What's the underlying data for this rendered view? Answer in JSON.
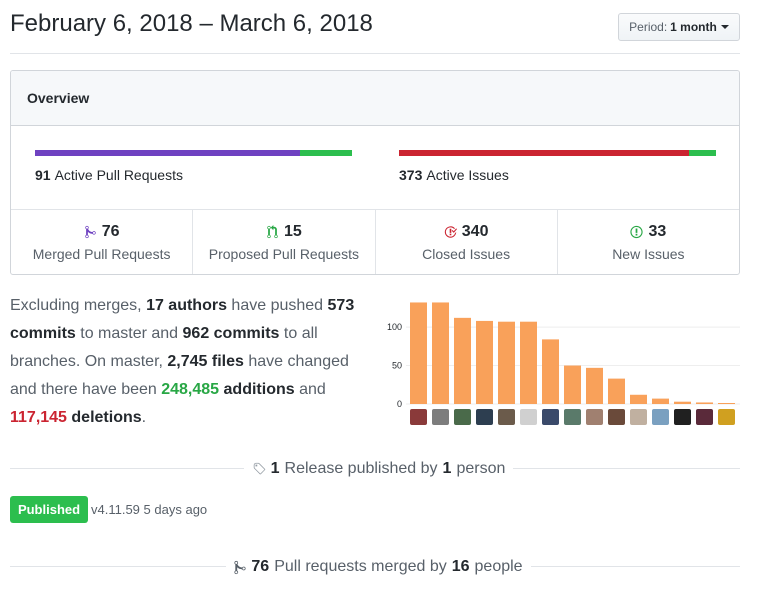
{
  "header": {
    "title": "February 6, 2018 – March 6, 2018",
    "period_label": "Period:",
    "period_value": "1 month"
  },
  "overview": {
    "heading": "Overview",
    "pull_requests": {
      "count": "91",
      "label": "Active Pull Requests",
      "merged_fraction": 0.835,
      "colors": {
        "merged": "#6f42c1",
        "proposed": "#2cbe4e"
      }
    },
    "issues": {
      "count": "373",
      "label": "Active Issues",
      "closed_fraction": 0.915,
      "colors": {
        "closed": "#cb2431",
        "new": "#2cbe4e"
      }
    },
    "stats": [
      {
        "name": "merged-pull-requests",
        "icon": "git-merge-icon",
        "num": "76",
        "label": "Merged Pull Requests",
        "color": "#6f42c1"
      },
      {
        "name": "proposed-pull-requests",
        "icon": "git-pull-request-icon",
        "num": "15",
        "label": "Proposed Pull Requests",
        "color": "#28a745"
      },
      {
        "name": "closed-issues",
        "icon": "issue-closed-icon",
        "num": "340",
        "label": "Closed Issues",
        "color": "#cb2431"
      },
      {
        "name": "new-issues",
        "icon": "issue-opened-icon",
        "num": "33",
        "label": "New Issues",
        "color": "#28a745"
      }
    ]
  },
  "narrative": {
    "t1": "Excluding merges, ",
    "authors": "17 authors",
    "t2": " have pushed ",
    "commits_master": "573 commits",
    "t3": " to master and ",
    "commits_all": "962 commits",
    "t4": " to all branches. On master, ",
    "files": "2,745 files",
    "t5": " have changed and there have been ",
    "additions_num": "248,485",
    "additions_word": "additions",
    "t6": " and ",
    "deletions_num": "117,145",
    "deletions_word": "deletions",
    "t7": "."
  },
  "chart_data": {
    "type": "bar",
    "y_ticks": [
      "100",
      "50",
      "0"
    ],
    "ylim": [
      0,
      130
    ],
    "bar_color": "#f9a15a",
    "values": [
      132,
      132,
      112,
      108,
      107,
      107,
      84,
      50,
      47,
      33,
      12,
      7,
      3,
      2,
      1
    ],
    "avatar_colors": [
      "#8a3a3a",
      "#7d7d7d",
      "#4a6a4a",
      "#2d3e50",
      "#6b5b4b",
      "#d0d0d0",
      "#3a4a6a",
      "#5a7a6a",
      "#a08070",
      "#6a4a3a",
      "#c0b0a0",
      "#7aa0c0",
      "#202020",
      "#5a2a3a",
      "#d0a020"
    ]
  },
  "release": {
    "count": "1",
    "t1": "Release published by",
    "people": "1",
    "t2": "person",
    "badge": "Published",
    "version": "v4.11.59",
    "time": "5 days ago"
  },
  "merged_prs": {
    "count": "76",
    "t1": "Pull requests merged by",
    "people": "16",
    "t2": "people"
  }
}
